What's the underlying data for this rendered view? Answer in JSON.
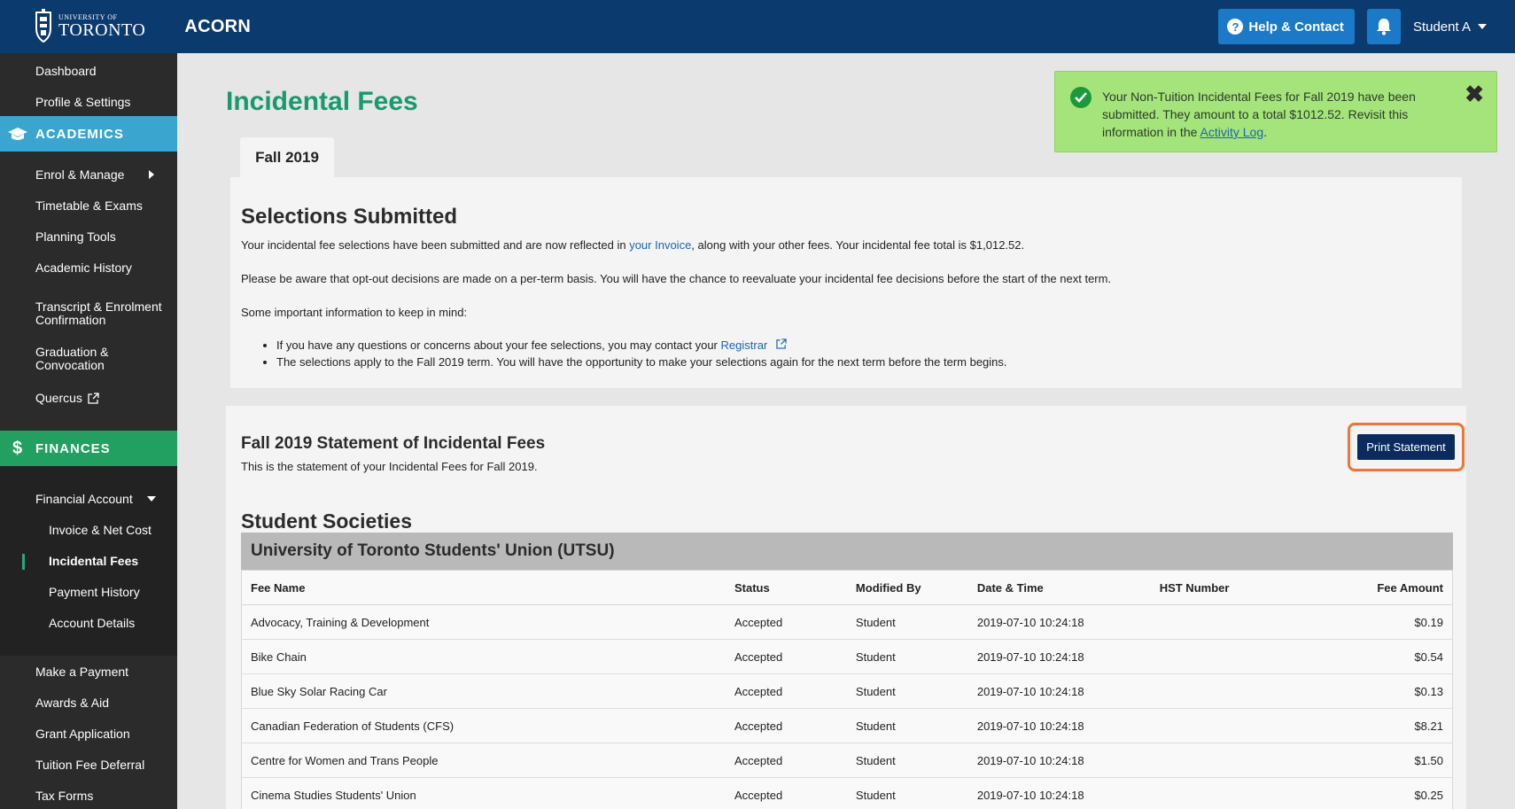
{
  "header": {
    "logo_small": "UNIVERSITY OF",
    "logo_big": "TORONTO",
    "app_name": "ACORN",
    "help_label": "Help & Contact",
    "help_icon_glyph": "?",
    "user_label": "Student A"
  },
  "sidebar": {
    "top_items": [
      "Dashboard",
      "Profile & Settings"
    ],
    "academics_label": "ACADEMICS",
    "academic_items": [
      "Enrol & Manage",
      "Timetable & Exams",
      "Planning Tools",
      "Academic History",
      "Transcript & Enrolment Confirmation",
      "Graduation & Convocation",
      "Quercus"
    ],
    "finances_label": "FINANCES",
    "finances_icon_glyph": "$",
    "financial_account": "Financial Account",
    "financial_sub": [
      "Invoice & Net Cost",
      "Incidental Fees",
      "Payment History",
      "Account Details"
    ],
    "other_items": [
      "Make a Payment",
      "Awards & Aid",
      "Grant Application",
      "Tuition Fee Deferral",
      "Tax Forms"
    ]
  },
  "alert": {
    "text_before": "Your Non-Tuition Incidental Fees for Fall 2019 have been submitted. They amount to a total $1012.52. Revisit this information in the ",
    "link": "Activity Log",
    "text_after": ".",
    "close_glyph": "✖"
  },
  "main": {
    "page_title": "Incidental Fees",
    "tab_label": "Fall 2019",
    "submitted_title": "Selections Submitted",
    "para1_before": "Your incidental fee selections have been submitted and are now reflected in ",
    "para1_link": "your Invoice",
    "para1_after": ", along with your other fees. Your incidental fee total is $1,012.52.",
    "para2": "Please be aware that opt-out decisions are made on a per-term basis. You will have the chance to reevaluate your incidental fee decisions before the start of the next term.",
    "para3": "Some important information to keep in mind:",
    "bullet1_before": "If you have any questions or concerns about your fee selections, you may contact your ",
    "bullet1_link": "Registrar",
    "bullet2": "The selections apply to the Fall 2019 term. You will have the opportunity to make your selections again for the next term before the term begins.",
    "statement_title": "Fall 2019 Statement of Incidental Fees",
    "statement_sub": "This is the statement of your Incidental Fees for Fall 2019.",
    "print_label": "Print Statement",
    "societies_title": "Student Societies",
    "utsu_title": "University of Toronto Students' Union (UTSU)"
  },
  "table": {
    "headers": [
      "Fee Name",
      "Status",
      "Modified By",
      "Date & Time",
      "HST Number",
      "Fee Amount"
    ],
    "rows": [
      [
        "Advocacy, Training & Development",
        "Accepted",
        "Student",
        "2019-07-10 10:24:18",
        "",
        "$0.19"
      ],
      [
        "Bike Chain",
        "Accepted",
        "Student",
        "2019-07-10 10:24:18",
        "",
        "$0.54"
      ],
      [
        "Blue Sky Solar Racing Car",
        "Accepted",
        "Student",
        "2019-07-10 10:24:18",
        "",
        "$0.13"
      ],
      [
        "Canadian Federation of Students (CFS)",
        "Accepted",
        "Student",
        "2019-07-10 10:24:18",
        "",
        "$8.21"
      ],
      [
        "Centre for Women and Trans People",
        "Accepted",
        "Student",
        "2019-07-10 10:24:18",
        "",
        "$1.50"
      ],
      [
        "Cinema Studies Students' Union",
        "Accepted",
        "Student",
        "2019-07-10 10:24:18",
        "",
        "$0.25"
      ]
    ]
  },
  "colors": {
    "header_bg": "#0b3a6e",
    "sidebar_bg": "#2b2b2b",
    "academics_band": "#3aa6cf",
    "finances_band": "#22a062",
    "title_green": "#169a6e",
    "alert_bg": "#a5e47a",
    "print_btn": "#0b2a5e",
    "highlight_border": "#f0733a"
  },
  "icons": [
    "uoft-crest-icon",
    "question-icon",
    "bell-icon",
    "caret-down-icon",
    "graduation-cap-icon",
    "dollar-icon",
    "chevron-right-icon",
    "external-link-icon",
    "check-circle-icon",
    "close-icon"
  ]
}
